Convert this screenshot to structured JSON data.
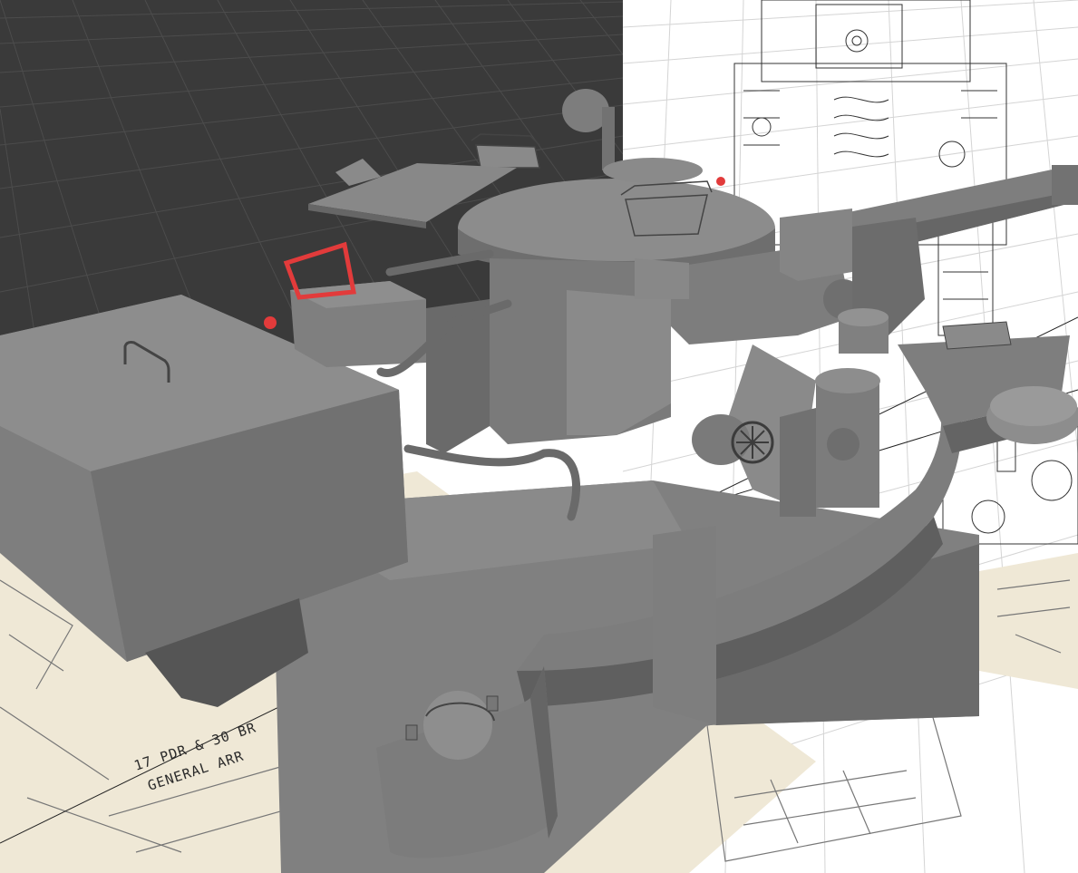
{
  "viewport": {
    "background_dark": "#3a3a3a",
    "background_light": "#ffffff",
    "grid_dark": "#4c4c4c",
    "grid_light": "#cfcfcf",
    "model_color": "#7a7a7a",
    "model_shadow": "#5e5e5e",
    "model_highlight": "#8e8e8e",
    "selection_color": "#e23b3b",
    "paper_color": "#efe8d6"
  },
  "blueprint": {
    "line1": "17 PDR & 30 BR",
    "line2": "GENERAL ARR"
  }
}
